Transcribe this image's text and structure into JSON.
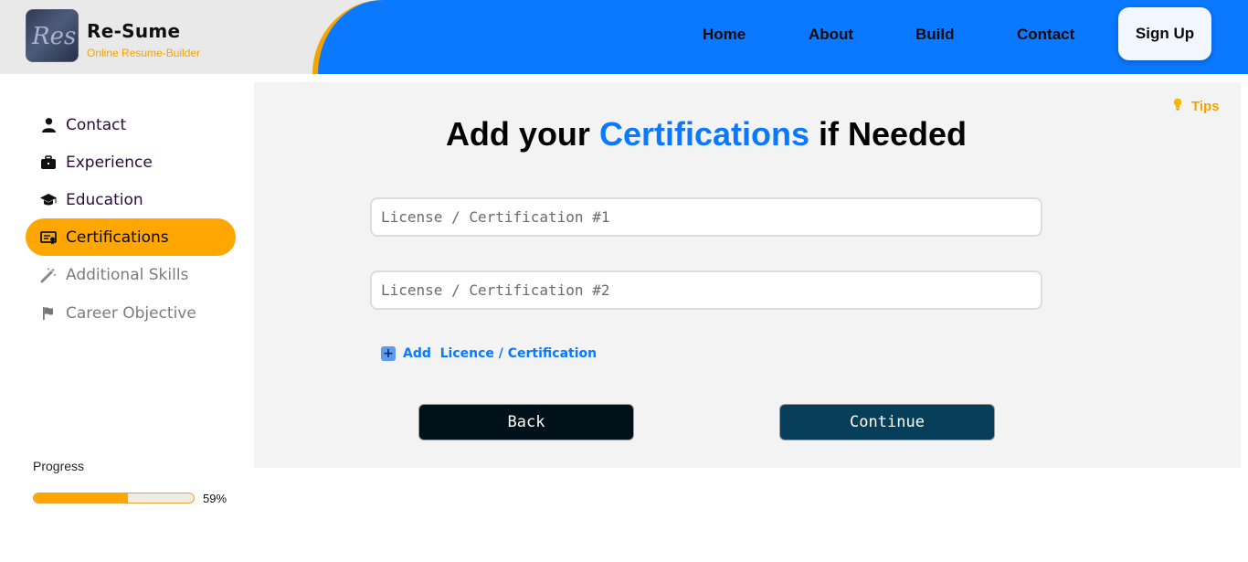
{
  "header": {
    "brand": "Re-Sume",
    "tagline": "Online Resume-Builder",
    "logo_text": "Res",
    "nav": [
      "Home",
      "About",
      "Build",
      "Contact"
    ],
    "signup": "Sign Up"
  },
  "sidebar": {
    "items": [
      {
        "label": "Contact",
        "icon": "user-icon",
        "state": "done"
      },
      {
        "label": "Experience",
        "icon": "briefcase-icon",
        "state": "done"
      },
      {
        "label": "Education",
        "icon": "graduation-cap-icon",
        "state": "done"
      },
      {
        "label": "Certifications",
        "icon": "certificate-icon",
        "state": "active"
      },
      {
        "label": "Additional Skills",
        "icon": "magic-wand-icon",
        "state": "todo"
      },
      {
        "label": "Career Objective",
        "icon": "flag-icon",
        "state": "todo"
      }
    ],
    "progress_label": "Progress",
    "progress_value": 0.59,
    "progress_text": "59%"
  },
  "main": {
    "tips": "Tips",
    "heading_pre": "Add your",
    "heading_highlight": "Certifications",
    "heading_post": "if Needed",
    "field1_placeholder": "License / Certification #1",
    "field2_placeholder": "License / Certification #2",
    "add_label": "Add  Licence / Certification",
    "back": "Back",
    "continue": "Continue"
  },
  "colors": {
    "accent_blue": "#0a78ff",
    "accent_orange": "#ffa600"
  }
}
